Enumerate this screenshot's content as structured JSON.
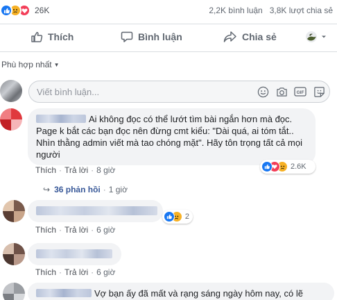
{
  "stats": {
    "reaction_count": "26K",
    "comments": "2,2K bình luận",
    "shares": "3,8K lượt chia sẻ"
  },
  "actions": {
    "like": "Thích",
    "comment": "Bình luận",
    "share": "Chia sẻ"
  },
  "sort": {
    "label": "Phù hợp nhất"
  },
  "composer": {
    "placeholder": "Viết bình luận..."
  },
  "comments": [
    {
      "text_line1": "Ai không đọc có thể lướt tìm bài ngắn hơn mà đọc.",
      "text_rest": "Page k bắt các bạn đọc nên đừng cmt kiểu: \"Dài quá, ai tóm tắt.. Nhìn thằng admin viết mà tao chóng mặt\". Hãy tôn trọng tất cả mọi người",
      "like": "Thích",
      "reply": "Trả lời",
      "time": "8 giờ",
      "reaction_count": "2.6K",
      "replies_label": "36 phản hồi",
      "replies_time": "1 giờ"
    },
    {
      "like": "Thích",
      "reply": "Trả lời",
      "time": "6 giờ",
      "reaction_count": "2"
    },
    {
      "like": "Thích",
      "reply": "Trả lời",
      "time": "6 giờ"
    },
    {
      "text": "Vợ bạn ấy đã mất và rạng sáng ngày hôm nay, có lẽ"
    }
  ],
  "colors": {
    "like_blue": "#1877f2",
    "love_red": "#f33e58",
    "sad_yellow": "#f7b125",
    "link_blue": "#385898"
  }
}
